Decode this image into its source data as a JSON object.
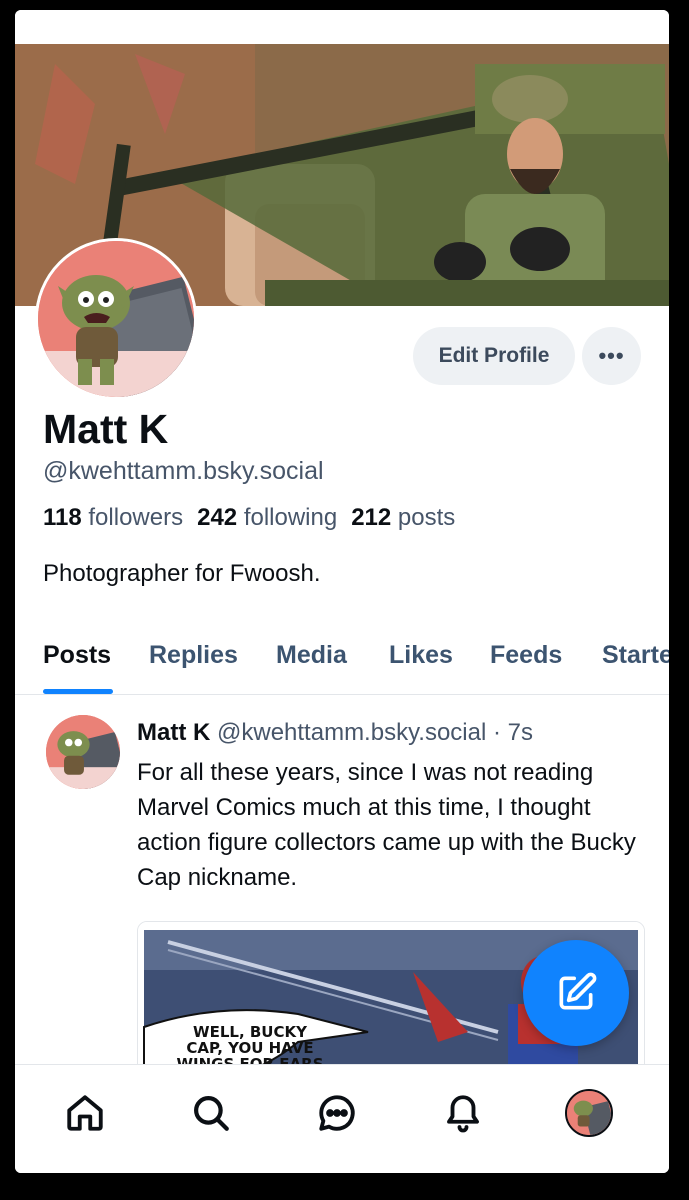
{
  "profile": {
    "display_name": "Matt K",
    "handle": "@kwehttamm.bsky.social",
    "followers_count": "118",
    "followers_label": "followers",
    "following_count": "242",
    "following_label": "following",
    "posts_count": "212",
    "posts_label": "posts",
    "bio": "Photographer for Fwoosh."
  },
  "actions": {
    "edit_profile_label": "Edit Profile",
    "more_label": "•••"
  },
  "tabs": [
    {
      "label": "Posts",
      "active": true
    },
    {
      "label": "Replies"
    },
    {
      "label": "Media"
    },
    {
      "label": "Likes"
    },
    {
      "label": "Feeds"
    },
    {
      "label": "Starte"
    }
  ],
  "post": {
    "author_name": "Matt K",
    "author_handle": "@kwehttamm.bsky.social",
    "time": "· 7s",
    "text": "For all these years, since I was not reading Marvel Comics much at this time, I thought action figure collectors came up with the Bucky Cap nickname.",
    "embed_caption_lines": [
      "WELL, BUCKY",
      "CAP, YOU HAVE",
      "WINGS FOR EARS"
    ]
  },
  "bottom_nav": [
    "home-icon",
    "search-icon",
    "chat-icon",
    "bell-icon",
    "profile-avatar"
  ],
  "colors": {
    "accent": "#1083fe",
    "text": "#0b0f14",
    "secondary": "#475569"
  }
}
